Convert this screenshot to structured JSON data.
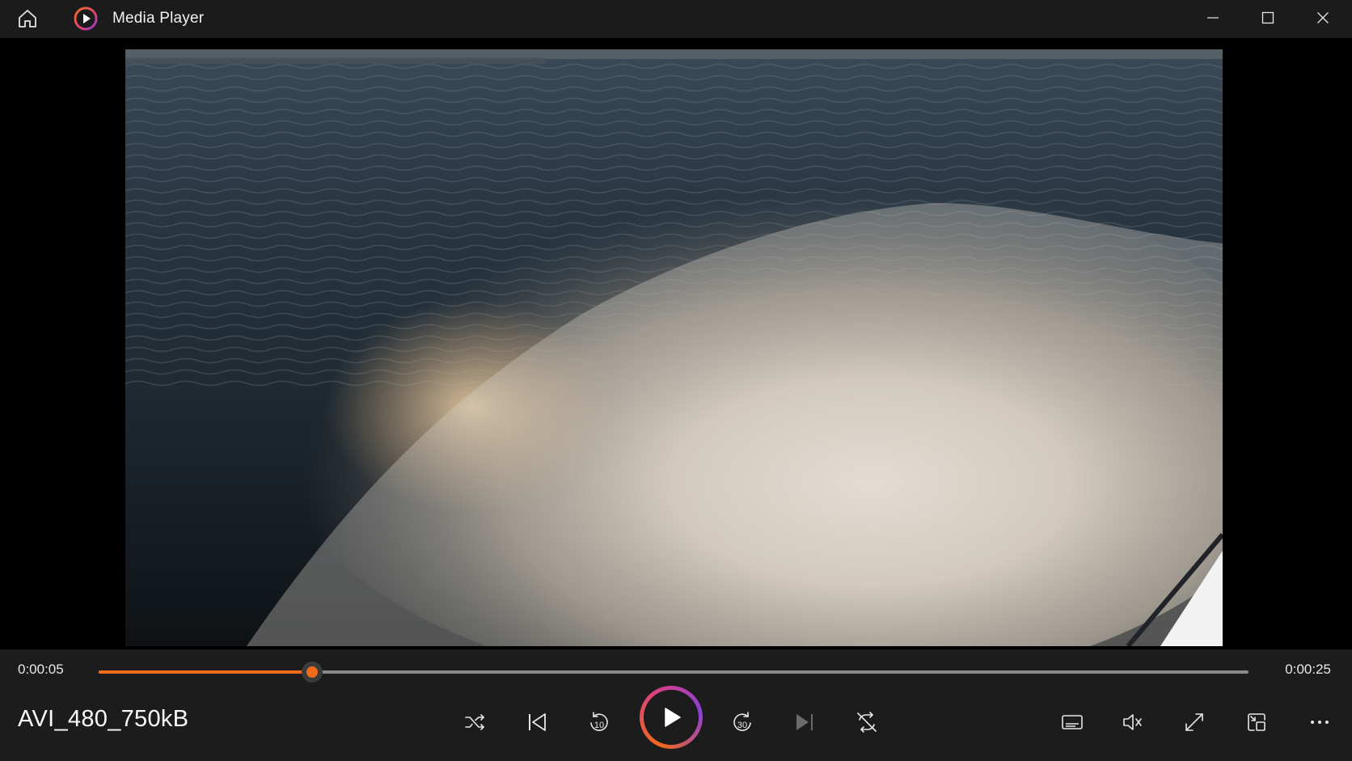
{
  "titlebar": {
    "title": "Media Player",
    "icons": [
      "home-icon",
      "app-logo",
      "minimize-icon",
      "maximize-icon",
      "close-icon"
    ]
  },
  "video": {
    "file_name": "AVI_480_750kB",
    "current_time": "0:00:05",
    "total_time": "0:00:25",
    "progress": 0.186
  },
  "controls": {
    "center": [
      "shuffle-icon",
      "previous-icon",
      "rewind-10-icon",
      "play-icon",
      "forward-30-icon",
      "next-icon",
      "repeat-off-icon"
    ],
    "rewind_seconds": "10",
    "forward_seconds": "30",
    "right": [
      "captions-icon",
      "volume-muted-icon",
      "fullscreen-icon",
      "mini-player-icon",
      "more-icon"
    ]
  },
  "colors": {
    "accent": "#f26b1d",
    "titlebar_bg": "#1b1b1b",
    "controls_bg": "#1c1c1c"
  }
}
